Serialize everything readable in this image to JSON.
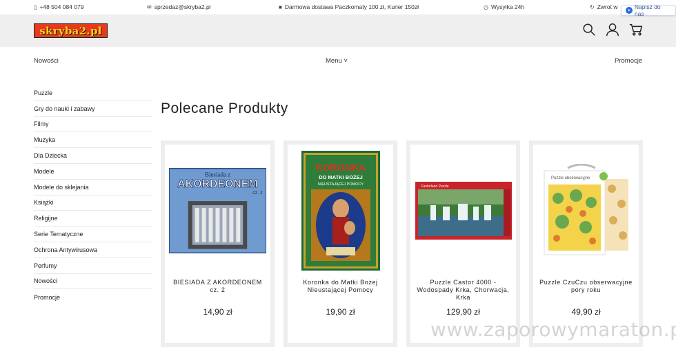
{
  "topbar": {
    "phone": "+48 504 084 079",
    "email": "sprzedaz@skryba2.pl",
    "shipping": "Darmowa dostawa Paczkomaty 100 zł, Kurier 150zł",
    "dispatch": "Wysyłka 24h",
    "returns": "Zwrot w",
    "message_button": "Napisz do nas"
  },
  "header": {
    "logo_text": "skryba2.pl",
    "icons": [
      "search-icon",
      "user-icon",
      "cart-icon"
    ]
  },
  "nav": {
    "new": "Nowości",
    "menu": "Menu ˅",
    "promo": "Promocje"
  },
  "sidebar": {
    "items": [
      "Puzzle",
      "Gry do nauki i zabawy",
      "Filmy",
      "Muzyka",
      "Dla Dziecka",
      "Modele",
      "Modele do sklejania",
      "Książki",
      "Religijne",
      "Serie Tematyczne",
      "Ochrona Antywirusowa",
      "Perfumy",
      "Nowości",
      "Promocje"
    ]
  },
  "main": {
    "title": "Polecane Produkty",
    "products": [
      {
        "name": "BIESIADA Z AKORDEONEM cz. 2",
        "price": "14,90 zł",
        "cover_line1": "Biesiada z",
        "cover_line2": "AKORDEONEM",
        "cover_line3": "cz. 2"
      },
      {
        "name": "Koronka do Matki Bożej Nieustającej Pomocy",
        "price": "19,90 zł",
        "cover_line1": "KORONKA",
        "cover_line2": "DO MATKI BOŻEJ",
        "cover_line3": "NIEUSTAJĄCEJ POMOCY"
      },
      {
        "name": "Puzzle Castor 4000 - Wodospady Krka, Chorwacja, Krka",
        "price": "129,90 zł",
        "cover_line1": "Castorland Puzzle",
        "cover_line2": "",
        "cover_line3": ""
      },
      {
        "name": "Puzzle CzuCzu obserwacyjne pory roku",
        "price": "49,90 zł",
        "cover_line1": "Puzzle obserwacyjne",
        "cover_line2": "",
        "cover_line3": ""
      }
    ]
  },
  "watermark": "www.zaporowymaraton.pl",
  "colors": {
    "logo_bg": "#e8381d",
    "logo_text": "#f5d21c",
    "header_bg": "#efefef",
    "card_bg": "#eeeeee"
  }
}
